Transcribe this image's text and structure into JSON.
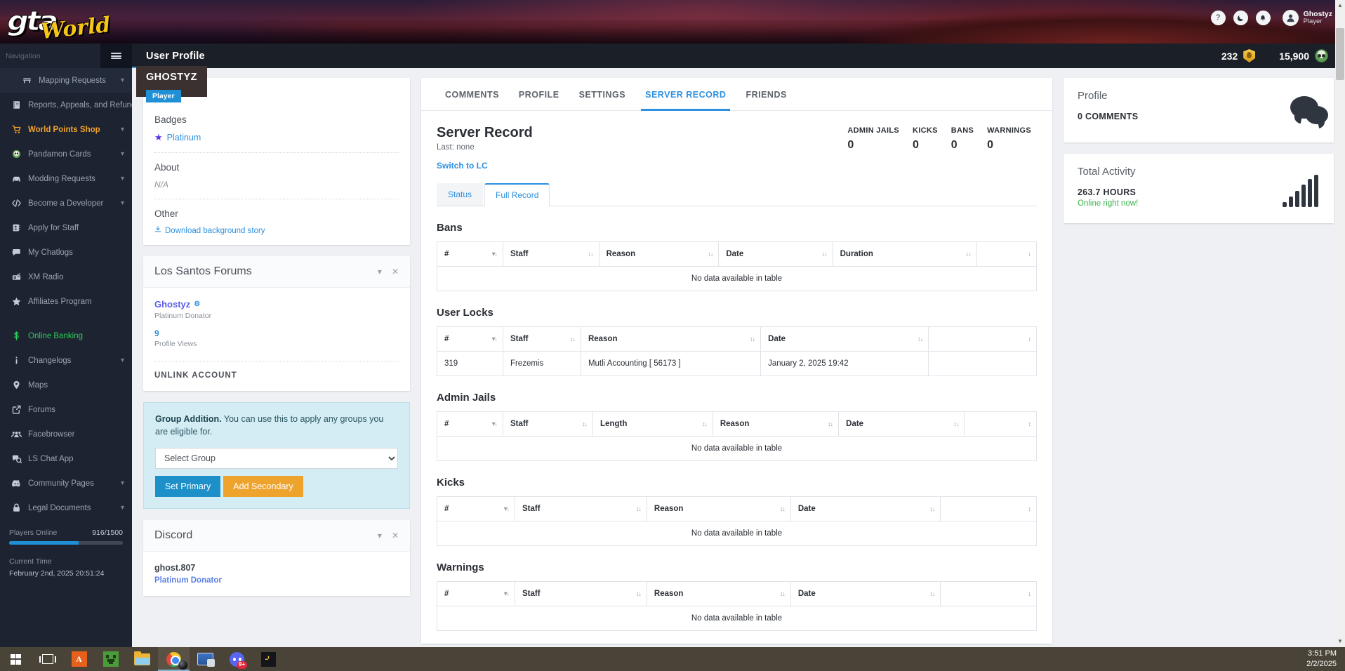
{
  "hero": {
    "logo_text_1": "gta",
    "logo_text_2": "World",
    "icons": [
      {
        "name": "help-icon",
        "glyph": "?"
      },
      {
        "name": "dark-mode-icon",
        "glyph": "☾"
      },
      {
        "name": "notifications-icon",
        "glyph": "ὑ4"
      }
    ],
    "user": {
      "name": "Ghostyz",
      "role": "Player"
    }
  },
  "sidebar": {
    "heading": "Navigation",
    "items": [
      {
        "label": "Mapping Requests",
        "icon": "bench-icon",
        "chevron": true,
        "style": "first"
      },
      {
        "label": "Reports, Appeals, and Refunds",
        "icon": "book-icon",
        "chevron": true,
        "style": ""
      },
      {
        "label": "World Points Shop",
        "icon": "cart-icon",
        "chevron": true,
        "style": "gold"
      },
      {
        "label": "Pandamon Cards",
        "icon": "panda-icon",
        "chevron": true,
        "style": ""
      },
      {
        "label": "Modding Requests",
        "icon": "car-icon",
        "chevron": true,
        "style": ""
      },
      {
        "label": "Become a Developer",
        "icon": "code-icon",
        "chevron": true,
        "style": ""
      },
      {
        "label": "Apply for Staff",
        "icon": "id-card-icon",
        "chevron": false,
        "style": ""
      },
      {
        "label": "My Chatlogs",
        "icon": "chat-icon",
        "chevron": false,
        "style": ""
      },
      {
        "label": "XM Radio",
        "icon": "radio-icon",
        "chevron": false,
        "style": ""
      },
      {
        "label": "Affiliates Program",
        "icon": "star-icon",
        "chevron": false,
        "style": ""
      },
      {
        "label": "Online Banking",
        "icon": "dollar-icon",
        "chevron": false,
        "style": "green gap"
      },
      {
        "label": "Changelogs",
        "icon": "info-icon",
        "chevron": true,
        "style": ""
      },
      {
        "label": "Maps",
        "icon": "map-pin-icon",
        "chevron": false,
        "style": ""
      },
      {
        "label": "Forums",
        "icon": "external-link-icon",
        "chevron": false,
        "style": ""
      },
      {
        "label": "Facebrowser",
        "icon": "users-icon",
        "chevron": false,
        "style": ""
      },
      {
        "label": "LS Chat App",
        "icon": "chats-icon",
        "chevron": false,
        "style": ""
      },
      {
        "label": "Community Pages",
        "icon": "discord-icon",
        "chevron": true,
        "style": ""
      },
      {
        "label": "Legal Documents",
        "icon": "lock-icon",
        "chevron": true,
        "style": ""
      }
    ],
    "players_online_label": "Players Online",
    "players_online_count": "916/1500",
    "current_time_label": "Current Time",
    "current_time_value": "February 2nd, 2025 20:51:24"
  },
  "appbar": {
    "title": "User Profile",
    "points_1": "232",
    "points_2": "15,900"
  },
  "profile_card": {
    "name": "GHOSTYZ",
    "tag": "Player",
    "badges_heading": "Badges",
    "badge_label": "Platinum",
    "about_heading": "About",
    "about_value": "N/A",
    "other_heading": "Other",
    "download_link": "Download background story"
  },
  "forums_card": {
    "title": "Los Santos Forums",
    "username": "Ghostyz",
    "donator": "Platinum Donator",
    "views_count": "9",
    "views_label": "Profile Views",
    "unlink_label": "UNLINK ACCOUNT"
  },
  "group_addition": {
    "bold": "Group Addition.",
    "text": " You can use this to apply any groups you are eligible for.",
    "select_value": "Select Group",
    "primary_button": "Set Primary",
    "secondary_button": "Add Secondary"
  },
  "discord_card": {
    "title": "Discord",
    "username": "ghost.807",
    "donator": "Platinum Donator"
  },
  "main": {
    "tabs": [
      {
        "label": "COMMENTS",
        "active": false
      },
      {
        "label": "PROFILE",
        "active": false
      },
      {
        "label": "SETTINGS",
        "active": false
      },
      {
        "label": "SERVER RECORD",
        "active": true
      },
      {
        "label": "FRIENDS",
        "active": false
      }
    ],
    "heading": "Server Record",
    "last": "Last: none",
    "switch_link": "Switch to LC",
    "stats": [
      {
        "key": "ADMIN JAILS",
        "value": "0"
      },
      {
        "key": "KICKS",
        "value": "0"
      },
      {
        "key": "BANS",
        "value": "0"
      },
      {
        "key": "WARNINGS",
        "value": "0"
      }
    ],
    "subtabs": [
      {
        "label": "Status",
        "active": false
      },
      {
        "label": "Full Record",
        "active": true
      }
    ],
    "empty_text": "No data available in table",
    "tables": [
      {
        "title": "Bans",
        "columns": [
          "#",
          "Staff",
          "Reason",
          "Date",
          "Duration",
          ""
        ],
        "widths": [
          "11%",
          "16%",
          "20%",
          "19%",
          "24%",
          "10%"
        ],
        "rows": []
      },
      {
        "title": "User Locks",
        "columns": [
          "#",
          "Staff",
          "Reason",
          "Date",
          ""
        ],
        "widths": [
          "11%",
          "13%",
          "30%",
          "28%",
          "18%"
        ],
        "rows": [
          [
            "319",
            "Frezemis",
            "Mutli Accounting [ 56173 ]",
            "January 2, 2025 19:42",
            ""
          ]
        ]
      },
      {
        "title": "Admin Jails",
        "columns": [
          "#",
          "Staff",
          "Length",
          "Reason",
          "Date",
          ""
        ],
        "widths": [
          "11%",
          "15%",
          "20%",
          "21%",
          "21%",
          "12%"
        ],
        "rows": []
      },
      {
        "title": "Kicks",
        "columns": [
          "#",
          "Staff",
          "Reason",
          "Date",
          ""
        ],
        "widths": [
          "13%",
          "22%",
          "24%",
          "25%",
          "16%"
        ],
        "rows": []
      },
      {
        "title": "Warnings",
        "columns": [
          "#",
          "Staff",
          "Reason",
          "Date",
          ""
        ],
        "widths": [
          "13%",
          "22%",
          "24%",
          "25%",
          "16%"
        ],
        "rows": []
      }
    ]
  },
  "right": {
    "profile_title": "Profile",
    "profile_value": "0 COMMENTS",
    "activity_title": "Total Activity",
    "activity_value": "263.7 HOURS",
    "activity_status": "Online right now!"
  },
  "taskbar": {
    "items": [
      {
        "name": "start-button"
      },
      {
        "name": "task-view-button"
      },
      {
        "name": "taskbar-app-a"
      },
      {
        "name": "taskbar-app-minecraft"
      },
      {
        "name": "taskbar-app-file-explorer"
      },
      {
        "name": "taskbar-app-chrome"
      },
      {
        "name": "taskbar-app-remote-desktop"
      },
      {
        "name": "taskbar-app-discord",
        "badge": "9+"
      },
      {
        "name": "taskbar-app-r"
      }
    ],
    "clock_time": "3:51 PM",
    "clock_date": "2/2/2025"
  },
  "colors": {
    "accent_blue": "#2e90e0",
    "gold": "#f0a22e",
    "green": "#3ab54a",
    "sidebar_bg": "#1d2331"
  }
}
